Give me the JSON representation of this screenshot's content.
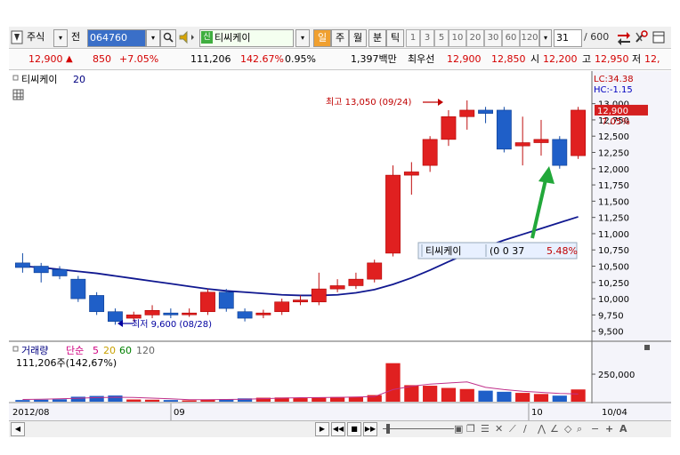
{
  "toolbar": {
    "market_label": "주식",
    "jeon_label": "전",
    "code_value": "064760",
    "stock_name": "티씨케이",
    "period_il": "일",
    "period_ju": "주",
    "period_wol": "월",
    "period_bun": "분",
    "period_tik": "틱",
    "tick_values": [
      "1",
      "3",
      "5",
      "10",
      "20",
      "30",
      "60",
      "120"
    ],
    "count_value": "31",
    "count_total": "/ 600"
  },
  "info": {
    "price": "12,900",
    "change": "850",
    "change_pct": "+7.05%",
    "volume": "111,206",
    "volume_ratio": "142.67%",
    "turnover": "0.95%",
    "amount": "1,397백만",
    "priority_label": "최우선",
    "ask": "12,900",
    "bid": "12,850",
    "open_label": "시",
    "open": "12,200",
    "high_label": "고",
    "high": "12,950",
    "low_label": "저",
    "low_truncated": "12,"
  },
  "chart_data": [
    {
      "type": "candlestick",
      "title": "티씨케이",
      "ma_label": "20",
      "y_ticks": [
        "13,000",
        "12,750",
        "12,500",
        "12,250",
        "12,000",
        "11,750",
        "11,500",
        "11,250",
        "11,000",
        "10,750",
        "10,500",
        "10,250",
        "10,000",
        "9,750",
        "9,500"
      ],
      "ylim": [
        9400,
        13200
      ],
      "x_labels": [
        "2012/08",
        "09",
        "10",
        "10/04"
      ],
      "lc_label": "LC:34.38",
      "hc_label": "HC:-1.15",
      "last_price_tag": "12,900",
      "last_pct_tag": "7.05%",
      "high_annotation": "최고 13,050 (09/24)",
      "low_annotation": "최저 9,600 (08/28)",
      "tooltip_name": "티씨케이",
      "tooltip_values": "(0 0 37",
      "tooltip_pct": "5.48%",
      "candles": [
        {
          "o": 10550,
          "c": 10480,
          "h": 10700,
          "l": 10400
        },
        {
          "o": 10500,
          "c": 10400,
          "h": 10550,
          "l": 10250
        },
        {
          "o": 10450,
          "c": 10350,
          "h": 10500,
          "l": 10300
        },
        {
          "o": 10300,
          "c": 10000,
          "h": 10350,
          "l": 9950
        },
        {
          "o": 10050,
          "c": 9800,
          "h": 10100,
          "l": 9750
        },
        {
          "o": 9800,
          "c": 9650,
          "h": 9850,
          "l": 9600
        },
        {
          "o": 9700,
          "c": 9750,
          "h": 9800,
          "l": 9650
        },
        {
          "o": 9750,
          "c": 9820,
          "h": 9900,
          "l": 9700
        },
        {
          "o": 9780,
          "c": 9750,
          "h": 9850,
          "l": 9700
        },
        {
          "o": 9760,
          "c": 9780,
          "h": 9850,
          "l": 9720
        },
        {
          "o": 9800,
          "c": 10100,
          "h": 10150,
          "l": 9750
        },
        {
          "o": 10100,
          "c": 9850,
          "h": 10150,
          "l": 9800
        },
        {
          "o": 9800,
          "c": 9700,
          "h": 9850,
          "l": 9650
        },
        {
          "o": 9750,
          "c": 9780,
          "h": 9830,
          "l": 9700
        },
        {
          "o": 9800,
          "c": 9950,
          "h": 10000,
          "l": 9750
        },
        {
          "o": 9950,
          "c": 9980,
          "h": 10050,
          "l": 9900
        },
        {
          "o": 9950,
          "c": 10150,
          "h": 10400,
          "l": 9900
        },
        {
          "o": 10150,
          "c": 10200,
          "h": 10300,
          "l": 10100
        },
        {
          "o": 10200,
          "c": 10300,
          "h": 10400,
          "l": 10150
        },
        {
          "o": 10300,
          "c": 10550,
          "h": 10600,
          "l": 10250
        },
        {
          "o": 10700,
          "c": 11900,
          "h": 12050,
          "l": 10650
        },
        {
          "o": 11900,
          "c": 11950,
          "h": 12100,
          "l": 11600
        },
        {
          "o": 12050,
          "c": 12450,
          "h": 12500,
          "l": 11950
        },
        {
          "o": 12450,
          "c": 12800,
          "h": 12900,
          "l": 12350
        },
        {
          "o": 12800,
          "c": 12900,
          "h": 13050,
          "l": 12600
        },
        {
          "o": 12900,
          "c": 12850,
          "h": 12950,
          "l": 12700
        },
        {
          "o": 12900,
          "c": 12300,
          "h": 12950,
          "l": 12250
        },
        {
          "o": 12350,
          "c": 12400,
          "h": 12800,
          "l": 12050
        },
        {
          "o": 12400,
          "c": 12450,
          "h": 12750,
          "l": 12200
        },
        {
          "o": 12450,
          "c": 12050,
          "h": 12500,
          "l": 12000
        },
        {
          "o": 12200,
          "c": 12900,
          "h": 12950,
          "l": 12150
        }
      ],
      "ma20": [
        10500,
        10480,
        10450,
        10420,
        10390,
        10350,
        10310,
        10270,
        10230,
        10190,
        10150,
        10120,
        10100,
        10080,
        10060,
        10050,
        10050,
        10060,
        10090,
        10140,
        10220,
        10320,
        10440,
        10570,
        10690,
        10800,
        10900,
        10990,
        11080,
        11170,
        11260
      ]
    },
    {
      "type": "bar",
      "title": "거래량",
      "legend": [
        "단순",
        "5",
        "20",
        "60",
        "120"
      ],
      "current_label": "111,206주(142,67%)",
      "y_ticks": [
        "250,000"
      ],
      "ylim": [
        0,
        420000
      ],
      "values": [
        15000,
        18000,
        22000,
        45000,
        52000,
        56000,
        20000,
        18000,
        15000,
        12000,
        20000,
        24000,
        30000,
        36000,
        38000,
        32000,
        40000,
        42000,
        45000,
        60000,
        350000,
        150000,
        145000,
        125000,
        115000,
        100000,
        90000,
        80000,
        70000,
        55000,
        111206
      ],
      "ma5": [
        20000,
        22000,
        26000,
        31000,
        37000,
        40000,
        38000,
        32000,
        26000,
        18000,
        18000,
        20000,
        22000,
        27000,
        32000,
        36000,
        37000,
        39000,
        42000,
        46000,
        110000,
        140000,
        160000,
        170000,
        180000,
        130000,
        110000,
        95000,
        85000,
        75000,
        70000
      ]
    }
  ],
  "bottom": {
    "letter_a": "A"
  }
}
